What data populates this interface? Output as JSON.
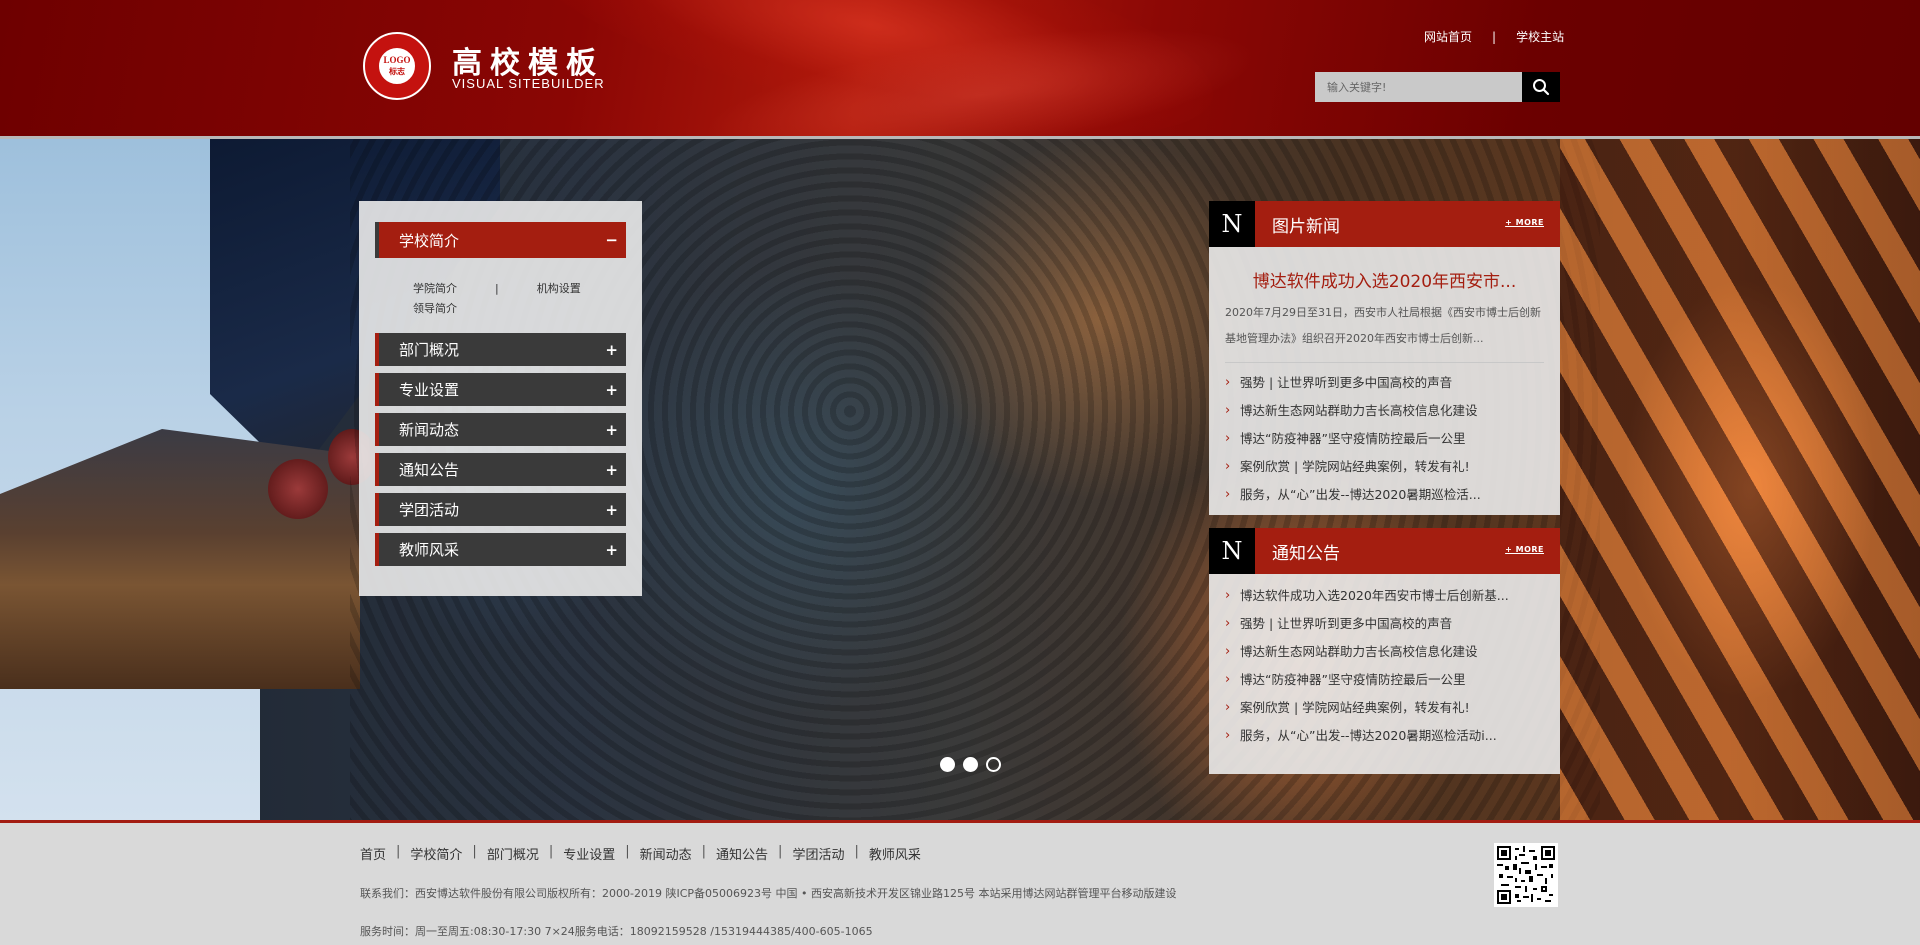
{
  "header": {
    "logo_seal_text": "LOGO",
    "logo_seal_cn": "标志",
    "site_title": "高校模板",
    "site_subtitle": "VISUAL  SITEBUILDER",
    "top_links": [
      "网站首页",
      "学校主站"
    ],
    "top_link_separator": "|",
    "search_placeholder": "输入关键字!",
    "search_icon": "search-icon"
  },
  "sidebar": {
    "active_section": {
      "label": "学校简介",
      "toggle": "−",
      "sub_links": [
        "学院简介",
        "机构设置",
        "领导简介"
      ],
      "sub_separator": "|"
    },
    "sections": [
      {
        "label": "部门概况",
        "toggle": "+"
      },
      {
        "label": "专业设置",
        "toggle": "+"
      },
      {
        "label": "新闻动态",
        "toggle": "+"
      },
      {
        "label": "通知公告",
        "toggle": "+"
      },
      {
        "label": "学团活动",
        "toggle": "+"
      },
      {
        "label": "教师风采",
        "toggle": "+"
      }
    ]
  },
  "photo_news": {
    "n_badge": "N",
    "title": "图片新闻",
    "more": "+ MORE",
    "featured_title": "博达软件成功入选2020年西安市...",
    "featured_summary": "2020年7月29日至31日，西安市人社局根据《西安市博士后创新基地管理办法》组织召开2020年西安市博士后创新...",
    "items": [
      "强势 | 让世界听到更多中国高校的声音",
      "博达新生态网站群助力吉长高校信息化建设",
      "博达“防疫神器”坚守疫情防控最后一公里",
      "案例欣赏 | 学院网站经典案例，转发有礼!",
      "服务，从“心”出发--博达2020暑期巡检活..."
    ]
  },
  "notices": {
    "n_badge": "N",
    "title": "通知公告",
    "more": "+ MORE",
    "items": [
      "博达软件成功入选2020年西安市博士后创新基...",
      "强势 | 让世界听到更多中国高校的声音",
      "博达新生态网站群助力吉长高校信息化建设",
      "博达“防疫神器”坚守疫情防控最后一公里",
      "案例欣赏 | 学院网站经典案例，转发有礼!",
      "服务，从“心”出发--博达2020暑期巡检活动i..."
    ]
  },
  "carousel": {
    "slide_count": 3,
    "active_index": 2
  },
  "footer": {
    "nav": [
      "首页",
      "学校简介",
      "部门概况",
      "专业设置",
      "新闻动态",
      "通知公告",
      "学团活动",
      "教师风采"
    ],
    "nav_separator": "|",
    "copyright": "联系我们：西安博达软件股份有限公司版权所有：2000-2019 陕ICP备05006923号  中国 • 西安高新技术开发区锦业路125号 本站采用博达网站群管理平台移动版建设",
    "service": "服务时间：周一至周五:08:30-17:30    7×24服务电话：18092159528 /15319444385/400-605-1065"
  },
  "colors": {
    "brand_red": "#a41e10",
    "header_dark_red": "#6e0000",
    "dark_gray": "#3a3a3a"
  }
}
